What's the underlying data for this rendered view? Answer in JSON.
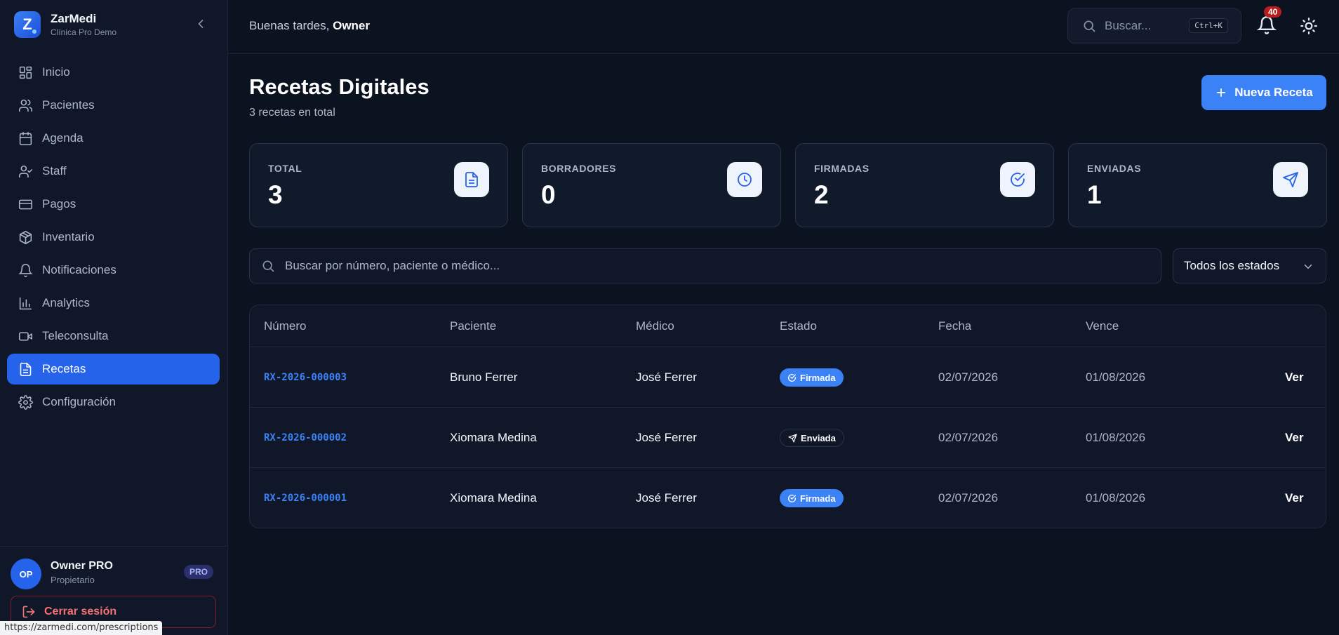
{
  "brand": {
    "logo_letter": "Z",
    "name": "ZarMedi",
    "subtitle": "Clínica Pro Demo"
  },
  "sidebar": {
    "items": [
      {
        "label": "Inicio",
        "icon": "dashboard-icon",
        "active": false
      },
      {
        "label": "Pacientes",
        "icon": "users-icon",
        "active": false
      },
      {
        "label": "Agenda",
        "icon": "calendar-icon",
        "active": false
      },
      {
        "label": "Staff",
        "icon": "user-check-icon",
        "active": false
      },
      {
        "label": "Pagos",
        "icon": "credit-card-icon",
        "active": false
      },
      {
        "label": "Inventario",
        "icon": "package-icon",
        "active": false
      },
      {
        "label": "Notificaciones",
        "icon": "bell-icon",
        "active": false
      },
      {
        "label": "Analytics",
        "icon": "bar-chart-icon",
        "active": false
      },
      {
        "label": "Teleconsulta",
        "icon": "video-icon",
        "active": false
      },
      {
        "label": "Recetas",
        "icon": "file-text-icon",
        "active": true
      },
      {
        "label": "Configuración",
        "icon": "gear-icon",
        "active": false
      }
    ]
  },
  "user": {
    "initials": "OP",
    "name": "Owner PRO",
    "role": "Propietario",
    "badge": "PRO",
    "logout_label": "Cerrar sesión"
  },
  "status_bar_url": "https://zarmedi.com/prescriptions",
  "header": {
    "greeting_prefix": "Buenas tardes,",
    "greeting_name": "Owner",
    "search_placeholder": "Buscar...",
    "search_shortcut": "Ctrl+K",
    "notification_count": "40"
  },
  "page": {
    "title": "Recetas Digitales",
    "subtitle": "3 recetas en total",
    "new_button": "Nueva Receta"
  },
  "stats": [
    {
      "label": "TOTAL",
      "value": "3",
      "icon": "file-text-icon"
    },
    {
      "label": "BORRADORES",
      "value": "0",
      "icon": "clock-icon"
    },
    {
      "label": "FIRMADAS",
      "value": "2",
      "icon": "check-circle-icon"
    },
    {
      "label": "ENVIADAS",
      "value": "1",
      "icon": "send-icon"
    }
  ],
  "filters": {
    "search_placeholder": "Buscar por número, paciente o médico...",
    "status_selected": "Todos los estados"
  },
  "table": {
    "columns": [
      "Número",
      "Paciente",
      "Médico",
      "Estado",
      "Fecha",
      "Vence"
    ],
    "rows": [
      {
        "numero": "RX-2026-000003",
        "paciente": "Bruno Ferrer",
        "medico": "José Ferrer",
        "estado": "Firmada",
        "fecha": "02/07/2026",
        "vence": "01/08/2026",
        "action": "Ver"
      },
      {
        "numero": "RX-2026-000002",
        "paciente": "Xiomara Medina",
        "medico": "José Ferrer",
        "estado": "Enviada",
        "fecha": "02/07/2026",
        "vence": "01/08/2026",
        "action": "Ver"
      },
      {
        "numero": "RX-2026-000001",
        "paciente": "Xiomara Medina",
        "medico": "José Ferrer",
        "estado": "Firmada",
        "fecha": "02/07/2026",
        "vence": "01/08/2026",
        "action": "Ver"
      }
    ]
  },
  "colors": {
    "accent": "#3b82f6",
    "active_nav": "#2563eb",
    "background": "#0b1220",
    "danger": "#f87171"
  }
}
